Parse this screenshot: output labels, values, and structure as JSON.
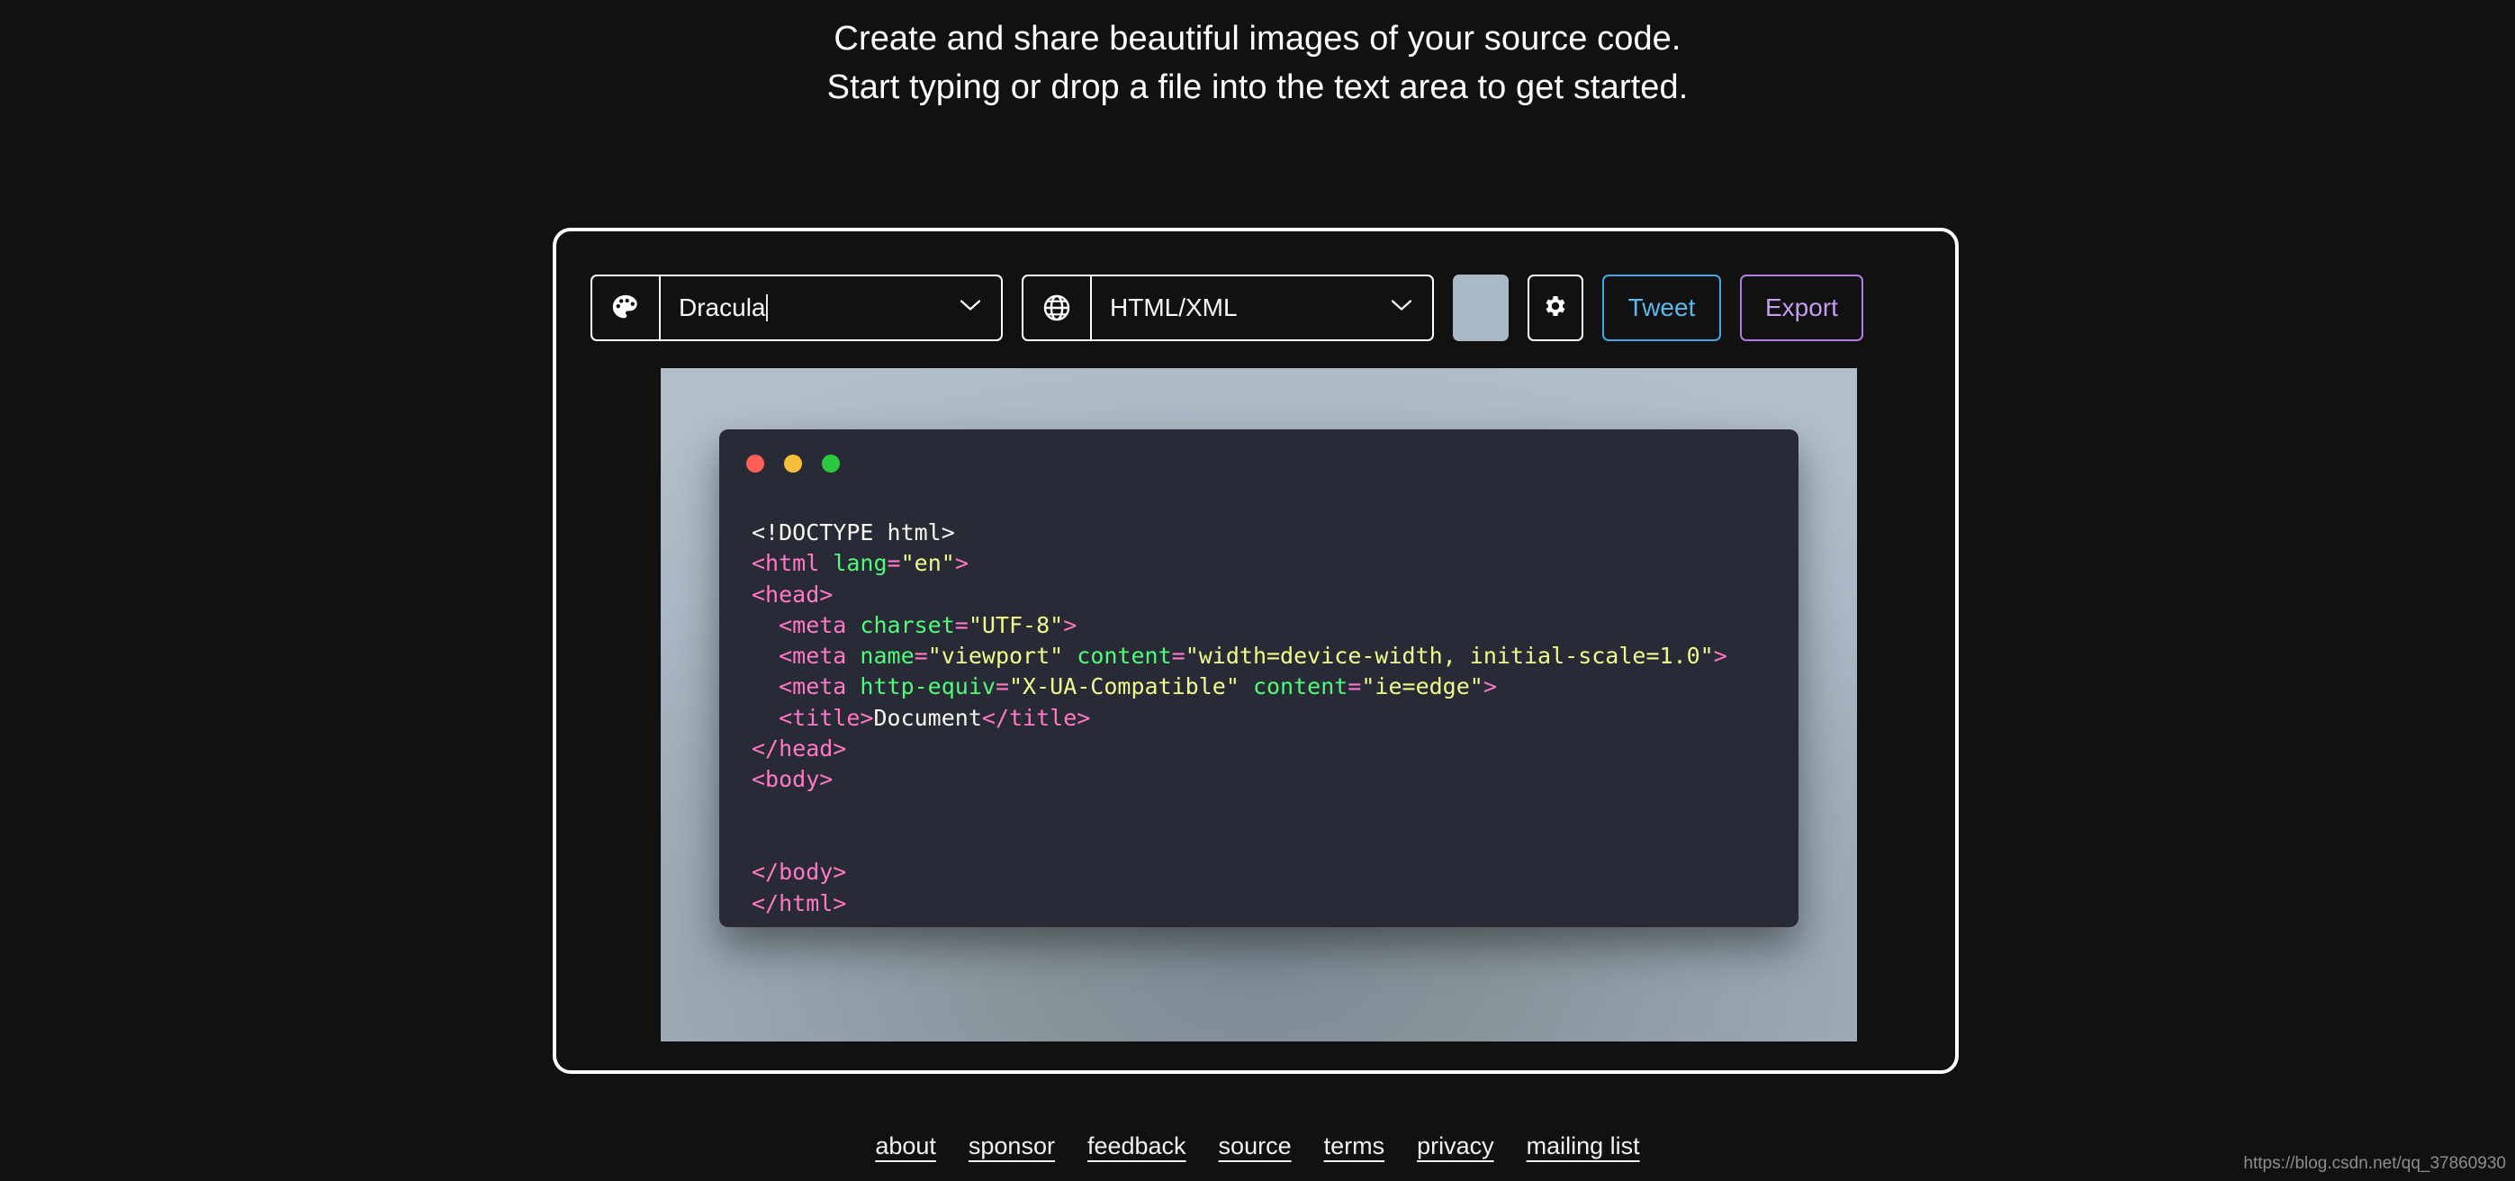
{
  "headline": {
    "line1": "Create and share beautiful images of your source code.",
    "line2": "Start typing or drop a file into the text area to get started."
  },
  "toolbar": {
    "theme_select": {
      "icon": "palette-icon",
      "value": "Dracula"
    },
    "language_select": {
      "icon": "globe-icon",
      "value": "HTML/XML"
    },
    "background_color_swatch": {
      "color": "#a9b9c5"
    },
    "settings_button": {
      "icon": "gear-icon"
    },
    "tweet_button": {
      "label": "Tweet",
      "color": "#5fb8ec"
    },
    "export_button": {
      "label": "Export",
      "color": "#c79bf2"
    }
  },
  "preview": {
    "window_dots": [
      "red",
      "yellow",
      "green"
    ],
    "code_lines": [
      [
        {
          "t": "plain",
          "s": "<!DOCTYPE html>"
        }
      ],
      [
        {
          "t": "tag",
          "s": "<html "
        },
        {
          "t": "attr",
          "s": "lang"
        },
        {
          "t": "tag",
          "s": "="
        },
        {
          "t": "str",
          "s": "\"en\""
        },
        {
          "t": "tag",
          "s": ">"
        }
      ],
      [
        {
          "t": "tag",
          "s": "<head>"
        }
      ],
      [
        {
          "t": "tag",
          "s": "  <meta "
        },
        {
          "t": "attr",
          "s": "charset"
        },
        {
          "t": "tag",
          "s": "="
        },
        {
          "t": "str",
          "s": "\"UTF-8\""
        },
        {
          "t": "tag",
          "s": ">"
        }
      ],
      [
        {
          "t": "tag",
          "s": "  <meta "
        },
        {
          "t": "attr",
          "s": "name"
        },
        {
          "t": "tag",
          "s": "="
        },
        {
          "t": "str",
          "s": "\"viewport\""
        },
        {
          "t": "plain",
          "s": " "
        },
        {
          "t": "attr",
          "s": "content"
        },
        {
          "t": "tag",
          "s": "="
        },
        {
          "t": "str",
          "s": "\"width=device-width, initial-scale=1.0\""
        },
        {
          "t": "tag",
          "s": ">"
        }
      ],
      [
        {
          "t": "tag",
          "s": "  <meta "
        },
        {
          "t": "attr",
          "s": "http-equiv"
        },
        {
          "t": "tag",
          "s": "="
        },
        {
          "t": "str",
          "s": "\"X-UA-Compatible\""
        },
        {
          "t": "plain",
          "s": " "
        },
        {
          "t": "attr",
          "s": "content"
        },
        {
          "t": "tag",
          "s": "="
        },
        {
          "t": "str",
          "s": "\"ie=edge\""
        },
        {
          "t": "tag",
          "s": ">"
        }
      ],
      [
        {
          "t": "tag",
          "s": "  <title>"
        },
        {
          "t": "plain",
          "s": "Document"
        },
        {
          "t": "tag",
          "s": "</title>"
        }
      ],
      [
        {
          "t": "tag",
          "s": "</head>"
        }
      ],
      [
        {
          "t": "tag",
          "s": "<body>"
        }
      ],
      [
        {
          "t": "plain",
          "s": ""
        }
      ],
      [
        {
          "t": "plain",
          "s": ""
        }
      ],
      [
        {
          "t": "tag",
          "s": "</body>"
        }
      ],
      [
        {
          "t": "tag",
          "s": "</html>"
        }
      ]
    ]
  },
  "footer": {
    "links": [
      {
        "label": "about"
      },
      {
        "label": "sponsor"
      },
      {
        "label": "feedback"
      },
      {
        "label": "source"
      },
      {
        "label": "terms"
      },
      {
        "label": "privacy"
      },
      {
        "label": "mailing list"
      }
    ]
  },
  "watermark": "https://blog.csdn.net/qq_37860930"
}
